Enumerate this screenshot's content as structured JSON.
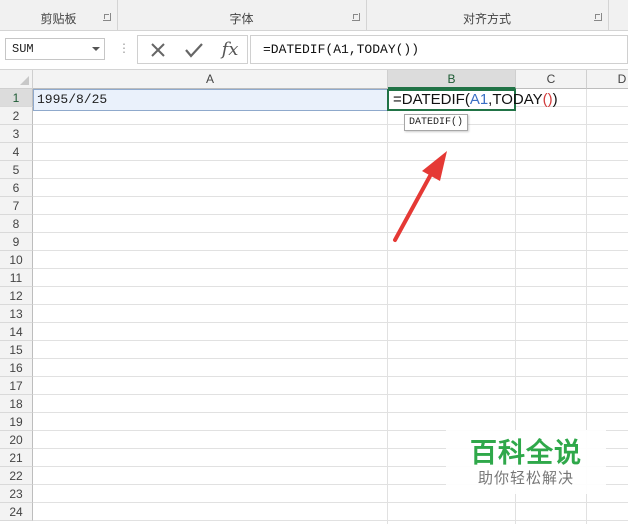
{
  "ribbon": {
    "groups": [
      {
        "label": "剪贴板"
      },
      {
        "label": "字体"
      },
      {
        "label": "对齐方式"
      }
    ]
  },
  "formula_bar": {
    "name_box": "SUM",
    "cancel_icon": "x-icon",
    "enter_icon": "check-icon",
    "fx_label": "fx",
    "formula": "=DATEDIF(A1,TODAY())"
  },
  "sheet": {
    "columns": [
      "A",
      "B",
      "C",
      "D"
    ],
    "selected_column": "B",
    "rows": [
      "1",
      "2",
      "3",
      "4",
      "5",
      "6",
      "7",
      "8",
      "9",
      "10",
      "11",
      "12",
      "13",
      "14",
      "15",
      "16",
      "17",
      "18",
      "19",
      "20",
      "21",
      "22",
      "23",
      "24"
    ],
    "cells": {
      "A1": "1995/8/25",
      "B1": {
        "eq": "=DATEDIF(",
        "ref": "A1",
        "comma": ",TODAY",
        "parens": "()",
        "close": ")"
      }
    },
    "tooltip": "DATEDIF()"
  },
  "annotation": {
    "arrow_color": "#e53935"
  },
  "watermark": {
    "title": "百科全说",
    "subtitle": "助你轻松解决"
  },
  "colors": {
    "accent": "#217346",
    "ref": "#3a6fc4",
    "paren": "#d23c3c",
    "watermark": "#2fa84a"
  }
}
